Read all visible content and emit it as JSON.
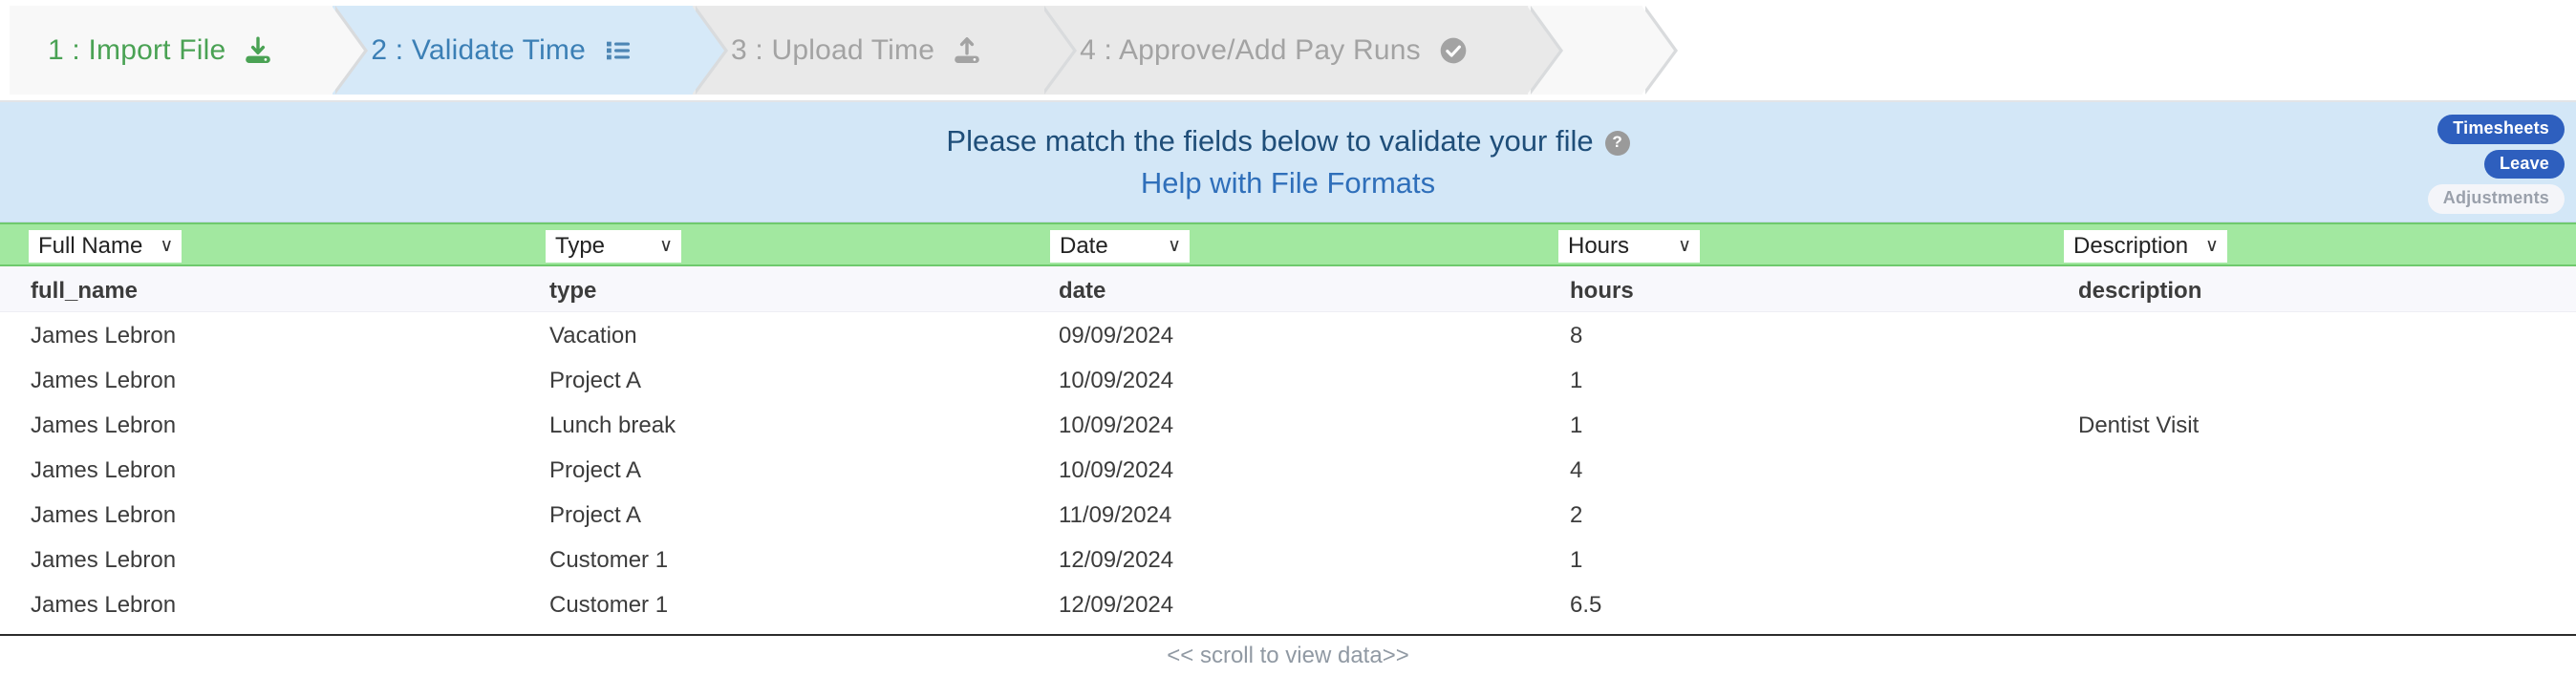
{
  "wizard": {
    "steps": [
      {
        "label": "1 : Import File",
        "icon": "download-icon",
        "state": "done"
      },
      {
        "label": "2 : Validate Time",
        "icon": "list-icon",
        "state": "active"
      },
      {
        "label": "3 : Upload Time",
        "icon": "upload-icon",
        "state": "todo"
      },
      {
        "label": "4 : Approve/Add Pay Runs",
        "icon": "check-circle-icon",
        "state": "todo"
      }
    ]
  },
  "banner": {
    "headline": "Please match the fields below to validate your file",
    "help_icon_glyph": "?",
    "help_link": "Help with File Formats",
    "badges": [
      {
        "label": "Timesheets",
        "active": true
      },
      {
        "label": "Leave",
        "active": true
      },
      {
        "label": "Adjustments",
        "active": false
      }
    ]
  },
  "mapping": {
    "selects": [
      {
        "value": "Full Name",
        "caret": "∨"
      },
      {
        "value": "Type",
        "caret": "∨"
      },
      {
        "value": "Date",
        "caret": "∨"
      },
      {
        "value": "Hours",
        "caret": "∨"
      },
      {
        "value": "Description",
        "caret": "∨"
      }
    ]
  },
  "table": {
    "columns": [
      "full_name",
      "type",
      "date",
      "hours",
      "description"
    ],
    "rows": [
      [
        "James Lebron",
        "Vacation",
        "09/09/2024",
        "8",
        ""
      ],
      [
        "James Lebron",
        "Project A",
        "10/09/2024",
        "1",
        ""
      ],
      [
        "James Lebron",
        "Lunch break",
        "10/09/2024",
        "1",
        "Dentist Visit"
      ],
      [
        "James Lebron",
        "Project A",
        "10/09/2024",
        "4",
        ""
      ],
      [
        "James Lebron",
        "Project A",
        "11/09/2024",
        "2",
        ""
      ],
      [
        "James Lebron",
        "Customer 1",
        "12/09/2024",
        "1",
        ""
      ],
      [
        "James Lebron",
        "Customer 1",
        "12/09/2024",
        "6.5",
        ""
      ]
    ]
  },
  "footer": {
    "scroll_hint": "<< scroll to view data>>"
  },
  "colors": {
    "step_done_text": "#4aa254",
    "step_active_text": "#3b7fb5",
    "step_todo_text": "#a3a3a3",
    "banner_bg": "#d3e7f7",
    "banner_text": "#1f4e79",
    "link": "#2f6fba",
    "mapping_bg": "#a2e8a0",
    "badge_on": "#2e5fbe",
    "badge_off": "#f4f5f9"
  }
}
